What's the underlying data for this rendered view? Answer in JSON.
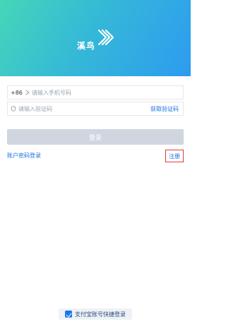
{
  "brand": {
    "logo_text": "溪鸟",
    "logo_mark_icon": "chevrons-logo-icon",
    "header_gradient": [
      "#46d6b8",
      "#2d9bf0"
    ]
  },
  "form": {
    "phone": {
      "prefix": "+86",
      "placeholder": "请输入手机号码",
      "value": ""
    },
    "code": {
      "placeholder": "请输入验证码",
      "value": "",
      "get_code_label": "获取验证码"
    }
  },
  "actions": {
    "login_label": "登录",
    "account_password_login_label": "账户密码登录",
    "register_label": "注册"
  },
  "footer": {
    "alipay_quick_login_label": "支付宝账号快捷登录"
  },
  "colors": {
    "accent_blue": "#1a6fe0",
    "login_disabled_bg": "#cfd6df",
    "highlight_border": "#e53935"
  }
}
